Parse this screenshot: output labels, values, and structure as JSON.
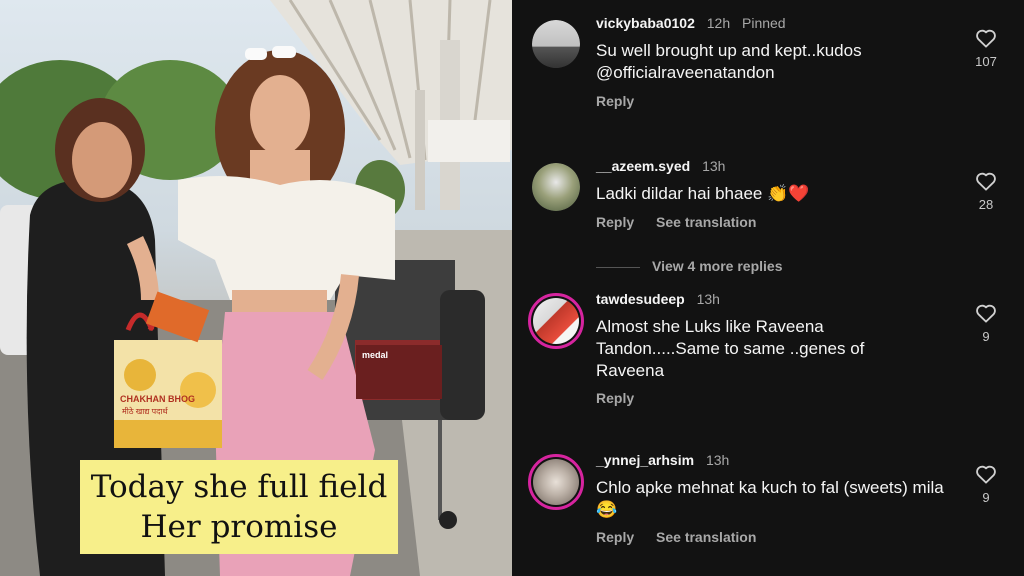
{
  "photo": {
    "caption_line1": "Today she full field",
    "caption_line2": "Her promise",
    "bag_text_top": "CHAKHAN BHOG",
    "bag_text_sub": "मीठे खाद्य पदार्थ",
    "board_text": "medal"
  },
  "comments": [
    {
      "username": "vickybaba0102",
      "time": "12h",
      "tag": "Pinned",
      "text": "Su well brought up and kept..kudos @officialraveenatandon",
      "reply": "Reply",
      "translate": "",
      "likes": "107"
    },
    {
      "username": "__azeem.syed",
      "time": "13h",
      "tag": "",
      "text": "Ladki dildar hai bhaee 👏❤️",
      "reply": "Reply",
      "translate": "See translation",
      "likes": "28"
    },
    {
      "username": "tawdesudeep",
      "time": "13h",
      "tag": "",
      "text": "Almost she Luks like Raveena Tandon.....Same to same ..genes of Raveena",
      "reply": "Reply",
      "translate": "",
      "likes": "9"
    },
    {
      "username": "_ynnej_arhsim",
      "time": "13h",
      "tag": "",
      "text": "Chlo apke mehnat ka kuch to fal (sweets) mila😂",
      "reply": "Reply",
      "translate": "See translation",
      "likes": "9"
    }
  ],
  "view_more": "View 4 more replies",
  "colors": {
    "background": "#121212",
    "text": "#f5f5f5",
    "muted": "#a8a8a8",
    "story_ring": "#d6249f",
    "caption_bg": "#f7ef8a"
  }
}
